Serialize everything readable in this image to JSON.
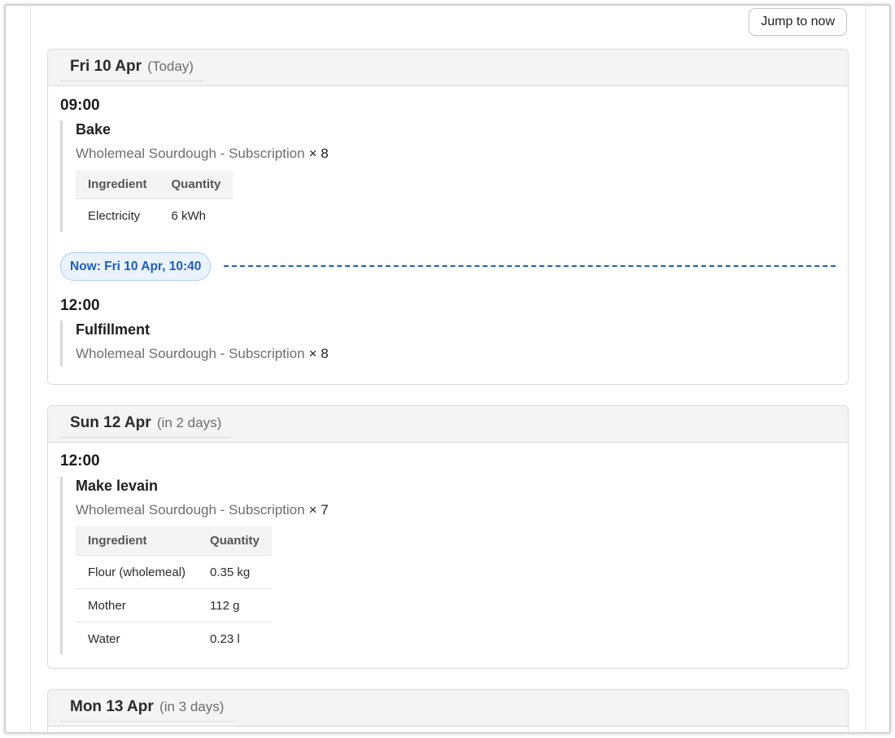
{
  "toolbar": {
    "jump_label": "Jump to now"
  },
  "days": [
    {
      "date": "Fri 10 Apr",
      "relative": "(Today)",
      "now_marker": "Now: Fri 10 Apr, 10:40",
      "slots": [
        {
          "time": "09:00",
          "task": {
            "title": "Bake",
            "product": "Wholemeal Sourdough - Subscription",
            "qty": "× 8",
            "headers": [
              "Ingredient",
              "Quantity"
            ],
            "rows": [
              {
                "ingredient": "Electricity",
                "quantity": "6 kWh"
              }
            ]
          }
        },
        {
          "time": "12:00",
          "task": {
            "title": "Fulfillment",
            "product": "Wholemeal Sourdough - Subscription",
            "qty": "× 8"
          }
        }
      ]
    },
    {
      "date": "Sun 12 Apr",
      "relative": "(in 2 days)",
      "slots": [
        {
          "time": "12:00",
          "task": {
            "title": "Make levain",
            "product": "Wholemeal Sourdough - Subscription",
            "qty": "× 7",
            "headers": [
              "Ingredient",
              "Quantity"
            ],
            "rows": [
              {
                "ingredient": "Flour (wholemeal)",
                "quantity": "0.35 kg"
              },
              {
                "ingredient": "Mother",
                "quantity": "112 g"
              },
              {
                "ingredient": "Water",
                "quantity": "0.23 l"
              }
            ]
          }
        }
      ]
    },
    {
      "date": "Mon 13 Apr",
      "relative": "(in 3 days)",
      "slots": []
    }
  ],
  "colors": {
    "accent": "#1f5fb8",
    "now_bg": "#eaf3fd",
    "header_bg": "#f4f4f4"
  }
}
